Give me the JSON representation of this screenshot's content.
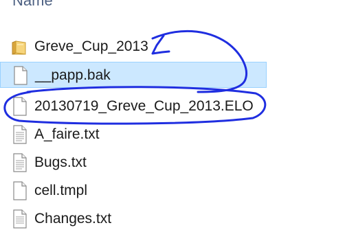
{
  "header": {
    "name_column": "Name"
  },
  "files": [
    {
      "name": "Greve_Cup_2013",
      "icon": "folder-icon"
    },
    {
      "name": "__papp.bak",
      "icon": "blank-file-icon"
    },
    {
      "name": "20130719_Greve_Cup_2013.ELO",
      "icon": "blank-file-icon"
    },
    {
      "name": "A_faire.txt",
      "icon": "text-file-icon"
    },
    {
      "name": "Bugs.txt",
      "icon": "text-file-icon"
    },
    {
      "name": "cell.tmpl",
      "icon": "blank-file-icon"
    },
    {
      "name": "Changes.txt",
      "icon": "text-file-icon"
    }
  ],
  "selection": {
    "selected_file": "__papp.bak"
  },
  "colors": {
    "selection_background": "#cce8ff",
    "selection_border": "#99d1ff",
    "folder": "#e8b84a",
    "annotation_ink": "#1f2ee0"
  }
}
